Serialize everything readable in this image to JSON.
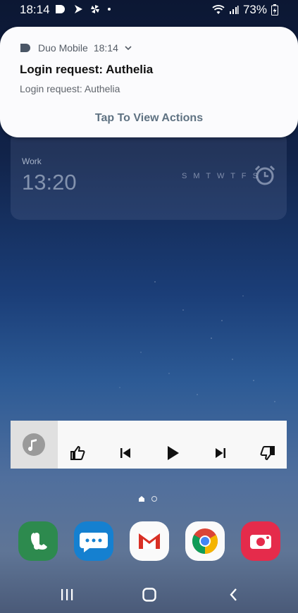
{
  "status_bar": {
    "time": "18:14",
    "battery": "73%",
    "left_icons": [
      "duo-icon",
      "navigation-icon",
      "pinwheel-icon",
      "dot-icon"
    ],
    "right_icons": [
      "wifi-icon",
      "signal-icon",
      "battery-icon"
    ]
  },
  "notification": {
    "app_name": "Duo Mobile",
    "time": "18:14",
    "title": "Login request: Authelia",
    "body": "Login request: Authelia",
    "action": "Tap To View Actions"
  },
  "alarm": {
    "label": "Work",
    "time": "13:20",
    "days": "S M T W T F S"
  },
  "music": {
    "controls": [
      "thumbs-up-icon",
      "previous-icon",
      "play-icon",
      "next-icon",
      "thumbs-down-icon"
    ]
  },
  "dock": {
    "apps": [
      "phone-icon",
      "messages-icon",
      "gmail-icon",
      "chrome-icon",
      "camera-icon"
    ]
  },
  "navbar": {
    "buttons": [
      "recents-icon",
      "home-icon",
      "back-icon"
    ]
  },
  "colors": {
    "accent_action": "#5f7282",
    "phone": "#2d8a4e",
    "messages": "#1580d0",
    "camera": "#e52b4b"
  }
}
